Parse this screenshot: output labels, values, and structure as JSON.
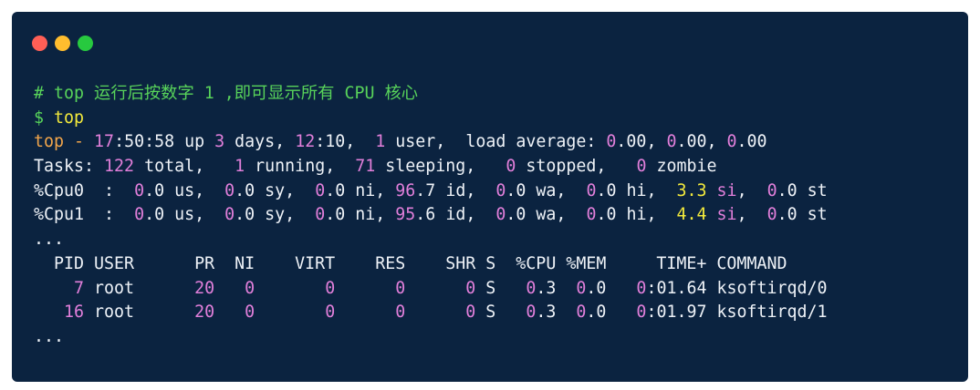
{
  "colors": {
    "background": "#0b2340",
    "page": "#ffffff",
    "text": "#eef2f7",
    "green": "#58d35a",
    "yellow": "#f3ea3c",
    "orange": "#f1a54b",
    "pink": "#e17fda",
    "dot_red": "#ff5f56",
    "dot_yellow": "#ffbd2e",
    "dot_green": "#27c93f"
  },
  "window_controls": [
    "close",
    "minimize",
    "maximize"
  ],
  "lines": [
    [
      {
        "t": "# top ",
        "c": "green"
      },
      {
        "t": "运行后按数字",
        "c": "green",
        "cjk": true
      },
      {
        "t": " 1 ,",
        "c": "green"
      },
      {
        "t": "即可显示所有",
        "c": "green",
        "cjk": true
      },
      {
        "t": " CPU ",
        "c": "green"
      },
      {
        "t": "核心",
        "c": "green",
        "cjk": true
      }
    ],
    [
      {
        "t": "$ ",
        "c": "green"
      },
      {
        "t": "top",
        "c": "yellow"
      }
    ],
    [
      {
        "t": "top - ",
        "c": "orange"
      },
      {
        "t": "17",
        "c": "pink"
      },
      {
        "t": ":50:58 up ",
        "c": "white"
      },
      {
        "t": "3",
        "c": "pink"
      },
      {
        "t": " days, ",
        "c": "white"
      },
      {
        "t": "12",
        "c": "pink"
      },
      {
        "t": ":10,  ",
        "c": "white"
      },
      {
        "t": "1",
        "c": "pink"
      },
      {
        "t": " user,  load average: ",
        "c": "white"
      },
      {
        "t": "0",
        "c": "pink"
      },
      {
        "t": ".00, ",
        "c": "white"
      },
      {
        "t": "0",
        "c": "pink"
      },
      {
        "t": ".00, ",
        "c": "white"
      },
      {
        "t": "0",
        "c": "pink"
      },
      {
        "t": ".00",
        "c": "white"
      }
    ],
    [
      {
        "t": "Tasks: ",
        "c": "white"
      },
      {
        "t": "122",
        "c": "pink"
      },
      {
        "t": " total,   ",
        "c": "white"
      },
      {
        "t": "1",
        "c": "pink"
      },
      {
        "t": " running,  ",
        "c": "white"
      },
      {
        "t": "71",
        "c": "pink"
      },
      {
        "t": " sleeping,   ",
        "c": "white"
      },
      {
        "t": "0",
        "c": "pink"
      },
      {
        "t": " stopped,   ",
        "c": "white"
      },
      {
        "t": "0",
        "c": "pink"
      },
      {
        "t": " zombie",
        "c": "white"
      }
    ],
    [
      {
        "t": "%Cpu0  :  ",
        "c": "white"
      },
      {
        "t": "0",
        "c": "pink"
      },
      {
        "t": ".0 us,  ",
        "c": "white"
      },
      {
        "t": "0",
        "c": "pink"
      },
      {
        "t": ".0 sy,  ",
        "c": "white"
      },
      {
        "t": "0",
        "c": "pink"
      },
      {
        "t": ".0 ni, ",
        "c": "white"
      },
      {
        "t": "96",
        "c": "pink"
      },
      {
        "t": ".7 id,  ",
        "c": "white"
      },
      {
        "t": "0",
        "c": "pink"
      },
      {
        "t": ".0 wa,  ",
        "c": "white"
      },
      {
        "t": "0",
        "c": "pink"
      },
      {
        "t": ".0 hi,  ",
        "c": "white"
      },
      {
        "t": "3.3 ",
        "c": "yellow"
      },
      {
        "t": "si",
        "c": "pink"
      },
      {
        "t": ",  ",
        "c": "white"
      },
      {
        "t": "0",
        "c": "pink"
      },
      {
        "t": ".0 st",
        "c": "white"
      }
    ],
    [
      {
        "t": "%Cpu1  :  ",
        "c": "white"
      },
      {
        "t": "0",
        "c": "pink"
      },
      {
        "t": ".0 us,  ",
        "c": "white"
      },
      {
        "t": "0",
        "c": "pink"
      },
      {
        "t": ".0 sy,  ",
        "c": "white"
      },
      {
        "t": "0",
        "c": "pink"
      },
      {
        "t": ".0 ni, ",
        "c": "white"
      },
      {
        "t": "95",
        "c": "pink"
      },
      {
        "t": ".6 id,  ",
        "c": "white"
      },
      {
        "t": "0",
        "c": "pink"
      },
      {
        "t": ".0 wa,  ",
        "c": "white"
      },
      {
        "t": "0",
        "c": "pink"
      },
      {
        "t": ".0 hi,  ",
        "c": "white"
      },
      {
        "t": "4.4 ",
        "c": "yellow"
      },
      {
        "t": "si",
        "c": "pink"
      },
      {
        "t": ",  ",
        "c": "white"
      },
      {
        "t": "0",
        "c": "pink"
      },
      {
        "t": ".0 st",
        "c": "white"
      }
    ],
    [
      {
        "t": "...",
        "c": "white"
      }
    ],
    [
      {
        "t": "  PID USER      PR  NI    VIRT    RES    SHR S  %CPU %MEM     TIME+ COMMAND",
        "c": "white"
      }
    ],
    [
      {
        "t": "    7",
        "c": "pink"
      },
      {
        "t": " root      ",
        "c": "white"
      },
      {
        "t": "20   0       0      0      0",
        "c": "pink"
      },
      {
        "t": " S   ",
        "c": "white"
      },
      {
        "t": "0",
        "c": "pink"
      },
      {
        "t": ".3  ",
        "c": "white"
      },
      {
        "t": "0",
        "c": "pink"
      },
      {
        "t": ".0   ",
        "c": "white"
      },
      {
        "t": "0",
        "c": "pink"
      },
      {
        "t": ":01.64 ksoftirqd/0",
        "c": "white"
      }
    ],
    [
      {
        "t": "   16",
        "c": "pink"
      },
      {
        "t": " root      ",
        "c": "white"
      },
      {
        "t": "20   0       0      0      0",
        "c": "pink"
      },
      {
        "t": " S   ",
        "c": "white"
      },
      {
        "t": "0",
        "c": "pink"
      },
      {
        "t": ".3  ",
        "c": "white"
      },
      {
        "t": "0",
        "c": "pink"
      },
      {
        "t": ".0   ",
        "c": "white"
      },
      {
        "t": "0",
        "c": "pink"
      },
      {
        "t": ":01.97 ksoftirqd/1",
        "c": "white"
      }
    ],
    [
      {
        "t": "...",
        "c": "white"
      }
    ]
  ]
}
